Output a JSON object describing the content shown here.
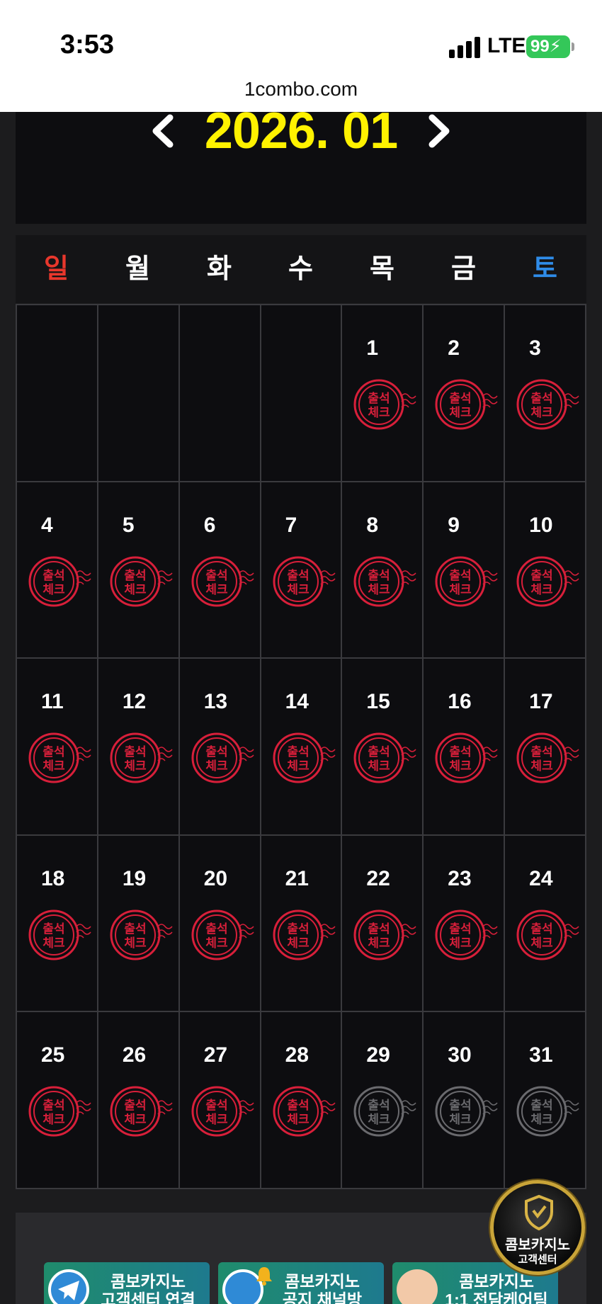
{
  "status_bar": {
    "time": "3:53",
    "network": "LTE",
    "battery": "99"
  },
  "browser": {
    "url": "1combo.com"
  },
  "calendar": {
    "month_title": "2026. 01",
    "weekdays": [
      "일",
      "월",
      "화",
      "수",
      "목",
      "금",
      "토"
    ],
    "weekday_colors": {
      "sunday": "#e8372c",
      "saturday": "#2f8ce8",
      "weekday": "#ffffff"
    },
    "days": [
      {
        "day": "",
        "stamp": "none"
      },
      {
        "day": "",
        "stamp": "none"
      },
      {
        "day": "",
        "stamp": "none"
      },
      {
        "day": "",
        "stamp": "none"
      },
      {
        "day": "1",
        "stamp": "checked"
      },
      {
        "day": "2",
        "stamp": "checked"
      },
      {
        "day": "3",
        "stamp": "checked"
      },
      {
        "day": "4",
        "stamp": "checked"
      },
      {
        "day": "5",
        "stamp": "checked"
      },
      {
        "day": "6",
        "stamp": "checked"
      },
      {
        "day": "7",
        "stamp": "checked"
      },
      {
        "day": "8",
        "stamp": "checked"
      },
      {
        "day": "9",
        "stamp": "checked"
      },
      {
        "day": "10",
        "stamp": "checked"
      },
      {
        "day": "11",
        "stamp": "checked"
      },
      {
        "day": "12",
        "stamp": "checked"
      },
      {
        "day": "13",
        "stamp": "checked"
      },
      {
        "day": "14",
        "stamp": "checked"
      },
      {
        "day": "15",
        "stamp": "checked"
      },
      {
        "day": "16",
        "stamp": "checked"
      },
      {
        "day": "17",
        "stamp": "checked"
      },
      {
        "day": "18",
        "stamp": "checked"
      },
      {
        "day": "19",
        "stamp": "checked"
      },
      {
        "day": "20",
        "stamp": "checked"
      },
      {
        "day": "21",
        "stamp": "checked"
      },
      {
        "day": "22",
        "stamp": "checked"
      },
      {
        "day": "23",
        "stamp": "checked"
      },
      {
        "day": "24",
        "stamp": "checked"
      },
      {
        "day": "25",
        "stamp": "checked"
      },
      {
        "day": "26",
        "stamp": "checked"
      },
      {
        "day": "27",
        "stamp": "checked"
      },
      {
        "day": "28",
        "stamp": "checked"
      },
      {
        "day": "29",
        "stamp": "unchecked"
      },
      {
        "day": "30",
        "stamp": "unchecked"
      },
      {
        "day": "31",
        "stamp": "unchecked"
      }
    ],
    "stamp_text_top": "출석",
    "stamp_text_bottom": "체크",
    "stamp_colors": {
      "checked": "#d81f3a",
      "unchecked": "#6a6a6e"
    }
  },
  "customer_center_badge": {
    "title": "콤보카지노",
    "subtitle": "고객센터"
  },
  "banners": [
    {
      "line1": "콤보카지노",
      "line2": "고객센터 연결"
    },
    {
      "line1": "콤보카지노",
      "line2": "공지 채널방"
    },
    {
      "line1": "콤보카지노",
      "line2": "1:1 전담케어팀"
    }
  ]
}
